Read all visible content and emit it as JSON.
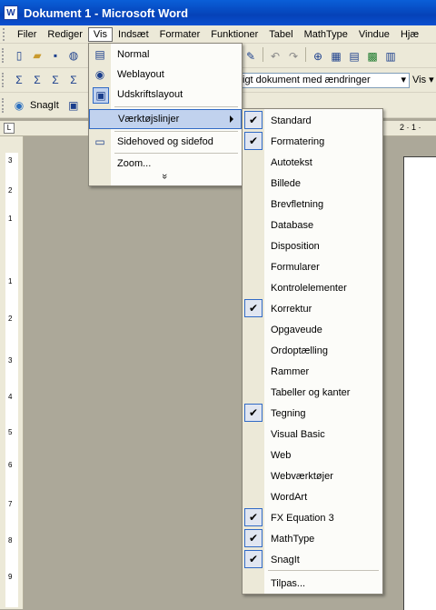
{
  "window": {
    "title": "Dokument 1 - Microsoft Word",
    "app_icon": "W"
  },
  "menubar": [
    "Filer",
    "Rediger",
    "Vis",
    "Indsæt",
    "Formater",
    "Funktioner",
    "Tabel",
    "MathType",
    "Vindue",
    "Hjæ"
  ],
  "toolbar": {
    "snagit_label": "SnagIt",
    "review_combo": "igt dokument med ændringer",
    "vis_button": "Vis ▾"
  },
  "vis_menu": [
    {
      "label": "Normal",
      "icon": "normal-view-icon",
      "glyph": "▤"
    },
    {
      "label": "Weblayout",
      "icon": "web-layout-icon",
      "glyph": "◉"
    },
    {
      "label": "Udskriftslayout",
      "icon": "print-layout-icon",
      "glyph": "▣"
    },
    {
      "label": "Værktøjslinjer",
      "icon": "",
      "glyph": ""
    },
    {
      "label": "Sidehoved og sidefod",
      "icon": "header-footer-icon",
      "glyph": "▭"
    },
    {
      "label": "Zoom...",
      "icon": "",
      "glyph": ""
    },
    {
      "label": "»",
      "icon": "expand-menu-icon",
      "glyph": ""
    }
  ],
  "toolbars_submenu": [
    {
      "label": "Standard",
      "checked": true
    },
    {
      "label": "Formatering",
      "checked": true
    },
    {
      "label": "Autotekst",
      "checked": false
    },
    {
      "label": "Billede",
      "checked": false
    },
    {
      "label": "Brevfletning",
      "checked": false
    },
    {
      "label": "Database",
      "checked": false
    },
    {
      "label": "Disposition",
      "checked": false
    },
    {
      "label": "Formularer",
      "checked": false
    },
    {
      "label": "Kontrolelementer",
      "checked": false
    },
    {
      "label": "Korrektur",
      "checked": true
    },
    {
      "label": "Opgaveude",
      "checked": false
    },
    {
      "label": "Ordoptælling",
      "checked": false
    },
    {
      "label": "Rammer",
      "checked": false
    },
    {
      "label": "Tabeller og kanter",
      "checked": false
    },
    {
      "label": "Tegning",
      "checked": true
    },
    {
      "label": "Visual Basic",
      "checked": false
    },
    {
      "label": "Web",
      "checked": false
    },
    {
      "label": "Webværktøjer",
      "checked": false
    },
    {
      "label": "WordArt",
      "checked": false
    },
    {
      "label": "FX Equation 3",
      "checked": true
    },
    {
      "label": "MathType",
      "checked": true
    },
    {
      "label": "SnagIt",
      "checked": true
    },
    {
      "label": "Tilpas...",
      "checked": false
    }
  ],
  "ruler": {
    "top_marks": "2 · 1 ·",
    "left_numbers": [
      "3",
      "2",
      "1",
      "1",
      "2",
      "3",
      "4",
      "5",
      "6",
      "7",
      "8",
      "9"
    ]
  },
  "colors": {
    "titlebar": "#0542b8",
    "highlight": "#c1d2ee",
    "highlight_border": "#316ac5",
    "workspace": "#aca899"
  }
}
